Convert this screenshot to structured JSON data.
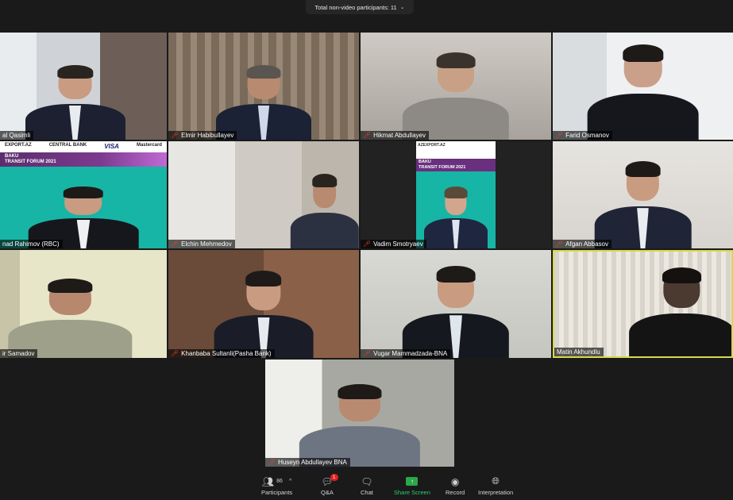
{
  "top_bar": {
    "label": "Total non-video participants: 11",
    "chevron": "⌄"
  },
  "banner": {
    "sponsors": [
      "EXPORT.AZ",
      "CENTRAL BANK",
      "VISA",
      "Mastercard"
    ],
    "title_lines": [
      "BAKU",
      "TRANSIT FORUM 2021"
    ]
  },
  "banner_right": {
    "sponsor": "AZEXPORT.AZ",
    "title_lines": [
      "BAKU",
      "TRANSIT FORUM 2021"
    ]
  },
  "participants": [
    {
      "name": "al Qasimli",
      "muted": false
    },
    {
      "name": "Elmir Habibullayev",
      "muted": true
    },
    {
      "name": "Hikmat Abdullayev",
      "muted": true
    },
    {
      "name": "Farid Osmanov",
      "muted": true
    },
    {
      "name": "nad Rahimov (RBC)",
      "muted": false
    },
    {
      "name": "Elchin Mehmedov",
      "muted": true
    },
    {
      "name": "Vadim Smotryaev",
      "muted": true
    },
    {
      "name": "Afgan Abbasov",
      "muted": true
    },
    {
      "name": "ir Samadov",
      "muted": false
    },
    {
      "name": "Khanbaba Sultanli(Pasha Bank)",
      "muted": true
    },
    {
      "name": "Vugar Mammadzada-BNA",
      "muted": true
    },
    {
      "name": "Matin Akhundlu",
      "muted": false
    },
    {
      "name": "Huseyn Abdullayev BNA",
      "muted": true
    }
  ],
  "toolbar": {
    "participants": {
      "label": "Participants",
      "count": "86",
      "icon": "participants-icon"
    },
    "qa": {
      "label": "Q&A",
      "badge": "1",
      "icon": "qa-icon"
    },
    "chat": {
      "label": "Chat",
      "icon": "chat-icon"
    },
    "share": {
      "label": "Share Screen",
      "icon": "share-screen-icon"
    },
    "record": {
      "label": "Record",
      "icon": "record-icon"
    },
    "interpretation": {
      "label": "Interpretation",
      "icon": "globe-icon"
    }
  },
  "colors": {
    "active_border": "#d7d94a",
    "share_green": "#2ba84a",
    "mute_red": "#e0452f"
  }
}
